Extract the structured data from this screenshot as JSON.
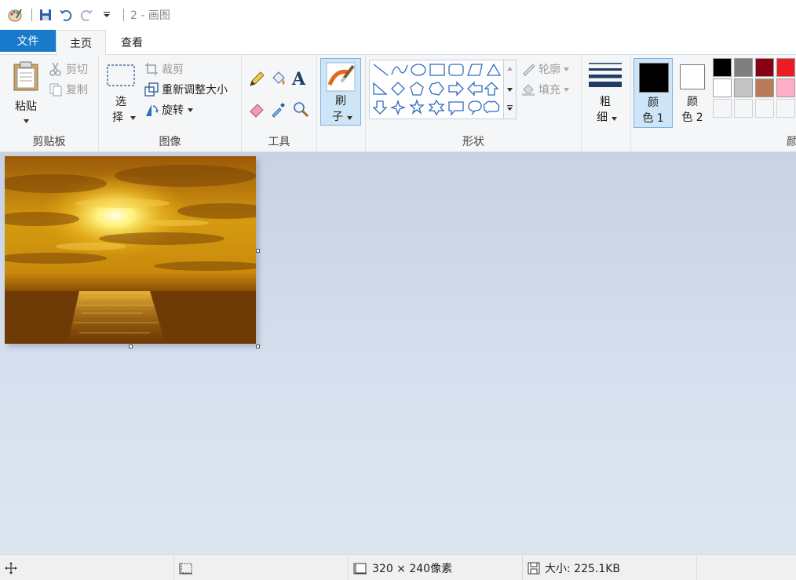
{
  "window": {
    "title": "2 - 画图"
  },
  "tabs": {
    "file": "文件",
    "home": "主页",
    "view": "查看"
  },
  "clipboard": {
    "paste": "粘贴",
    "cut": "剪切",
    "copy": "复制",
    "label": "剪贴板"
  },
  "image": {
    "select_line1": "选",
    "select_line2": "择",
    "crop": "裁剪",
    "resize": "重新调整大小",
    "rotate": "旋转",
    "label": "图像"
  },
  "tools": {
    "label": "工具",
    "text_glyph": "A"
  },
  "brushes": {
    "line1": "刷",
    "line2": "子"
  },
  "shapes": {
    "outline": "轮廓",
    "fill": "填充",
    "label": "形状"
  },
  "size": {
    "line1": "粗",
    "line2": "细"
  },
  "colors": {
    "color1_line1": "颜",
    "color1_line2": "色 1",
    "color2_line1": "颜",
    "color2_line2": "色 2",
    "label_partial": "颜",
    "color1": "#000000",
    "color2": "#ffffff",
    "palette_row1": [
      "#000000",
      "#7f7f7f",
      "#880015",
      "#ed1c24"
    ],
    "palette_row2": [
      "#ffffff",
      "#c3c3c3",
      "#b97a57",
      "#ffaec9"
    ],
    "palette_row3": [
      "#f5f6f7",
      "#f5f6f7",
      "#f5f6f7",
      "#f5f6f7"
    ]
  },
  "status": {
    "dimensions": "320 × 240像素",
    "filesize": "大小: 225.1KB"
  }
}
